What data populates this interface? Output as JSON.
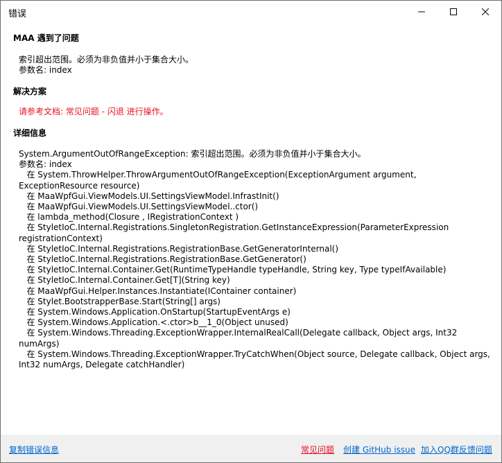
{
  "window": {
    "title": "错误",
    "minimize_icon": "minimize-icon",
    "maximize_icon": "maximize-icon",
    "close_icon": "close-icon"
  },
  "problem": {
    "heading": "MAA 遇到了问题",
    "message_line1": "索引超出范围。必须为非负值并小于集合大小。",
    "message_line2": "参数名: index"
  },
  "solution": {
    "heading": "解决方案",
    "text": "请参考文档: 常见问题 - 闪退 进行操作。"
  },
  "details": {
    "heading": "详细信息",
    "text": "System.ArgumentOutOfRangeException: 索引超出范围。必须为非负值并小于集合大小。\n参数名: index\n   在 System.ThrowHelper.ThrowArgumentOutOfRangeException(ExceptionArgument argument, ExceptionResource resource)\n   在 MaaWpfGui.ViewModels.UI.SettingsViewModel.InfrastInit()\n   在 MaaWpfGui.ViewModels.UI.SettingsViewModel..ctor()\n   在 lambda_method(Closure , IRegistrationContext )\n   在 StyletIoC.Internal.Registrations.SingletonRegistration.GetInstanceExpression(ParameterExpression registrationContext)\n   在 StyletIoC.Internal.Registrations.RegistrationBase.GetGeneratorInternal()\n   在 StyletIoC.Internal.Registrations.RegistrationBase.GetGenerator()\n   在 StyletIoC.Internal.Container.Get(RuntimeTypeHandle typeHandle, String key, Type typeIfAvailable)\n   在 StyletIoC.Internal.Container.Get[T](String key)\n   在 MaaWpfGui.Helper.Instances.Instantiate(IContainer container)\n   在 Stylet.BootstrapperBase.Start(String[] args)\n   在 System.Windows.Application.OnStartup(StartupEventArgs e)\n   在 System.Windows.Application.<.ctor>b__1_0(Object unused)\n   在 System.Windows.Threading.ExceptionWrapper.InternalRealCall(Delegate callback, Object args, Int32 numArgs)\n   在 System.Windows.Threading.ExceptionWrapper.TryCatchWhen(Object source, Delegate callback, Object args, Int32 numArgs, Delegate catchHandler)"
  },
  "footer": {
    "copy_label": "复制错误信息",
    "faq_label": "常见问题",
    "github_label": "创建 GitHub issue",
    "qq_label": "加入QQ群反馈问题"
  },
  "colors": {
    "link": "#0066cc",
    "error_red": "#e81123",
    "footer_bg": "#f0f0f0"
  }
}
